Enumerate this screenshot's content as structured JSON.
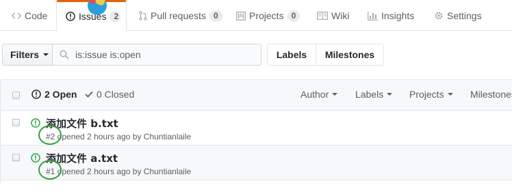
{
  "repo_nav": {
    "tabs": [
      {
        "label": "Code",
        "icon": "code-icon"
      },
      {
        "label": "Issues",
        "icon": "issue-opened-icon",
        "count": "2",
        "selected": true
      },
      {
        "label": "Pull requests",
        "icon": "git-pull-request-icon",
        "count": "0"
      },
      {
        "label": "Projects",
        "icon": "project-icon",
        "count": "0"
      },
      {
        "label": "Wiki",
        "icon": "book-icon"
      },
      {
        "label": "Insights",
        "icon": "graph-icon"
      },
      {
        "label": "Settings",
        "icon": "gear-icon"
      }
    ],
    "accent_color": "#e36209"
  },
  "filter_bar": {
    "filters_label": "Filters",
    "search_value": "is:issue is:open",
    "labels_label": "Labels",
    "milestones_label": "Milestones"
  },
  "issues_header": {
    "open_label": "2 Open",
    "closed_label": "0 Closed",
    "sort_menus": [
      "Author",
      "Labels",
      "Projects",
      "Milestones"
    ]
  },
  "issues": [
    {
      "title": "添加文件 b.txt",
      "meta": "#2 opened 2 hours ago by Chuntianlaile"
    },
    {
      "title": "添加文件 a.txt",
      "meta": "#1 opened 2 hours ago by Chuntianlaile"
    }
  ],
  "colors": {
    "open_green": "#28a745",
    "annotation_circle": "#2e9e3a"
  }
}
